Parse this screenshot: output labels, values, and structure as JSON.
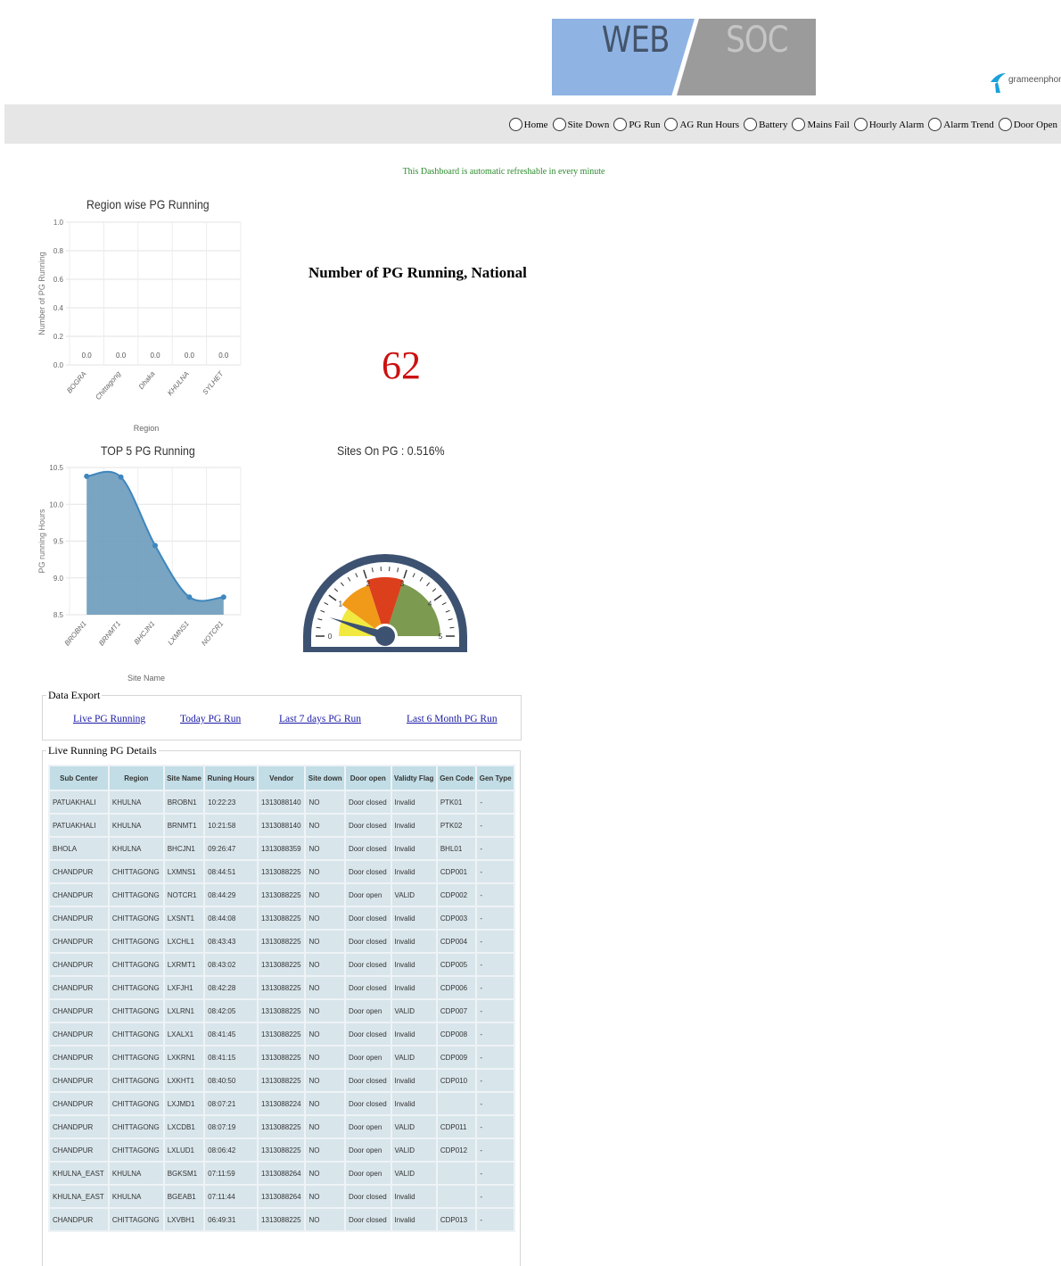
{
  "header": {
    "web_label": "WEB",
    "soc_label": "SOC",
    "logo_text": "grameenphone"
  },
  "nav": {
    "items": [
      "Home",
      "Site Down",
      "PG Run",
      "AG Run Hours",
      "Battery",
      "Mains Fail",
      "Hourly Alarm",
      "Alarm Trend",
      "Door Open"
    ]
  },
  "refresh_note": "This Dashboard is automatic refreshable in every minute",
  "national": {
    "title": "Number of PG Running, National",
    "value": "62"
  },
  "sites_on_pg": {
    "label": "Sites On PG : 0.516%",
    "gauge_value": 0.516,
    "gauge_min": 0,
    "gauge_max": 5,
    "ticks": [
      "0",
      "1",
      "2",
      "3",
      "4",
      "5"
    ]
  },
  "chart_data": [
    {
      "type": "bar",
      "title": "Region wise PG Running",
      "xlabel": "Region",
      "ylabel": "Number of PG Running",
      "categories": [
        "BOGRA",
        "Chittagong",
        "Dhaka",
        "KHULNA",
        "SYLHET"
      ],
      "values": [
        0.0,
        0.0,
        0.0,
        0.0,
        0.0
      ],
      "data_labels": [
        "0.0",
        "0.0",
        "0.0",
        "0.0",
        "0.0"
      ],
      "yticks": [
        "0.0",
        "0.2",
        "0.4",
        "0.6",
        "0.8",
        "1.0"
      ],
      "ylim": [
        0,
        1.0
      ],
      "grid": true
    },
    {
      "type": "area",
      "title": "TOP 5 PG Running",
      "xlabel": "Site Name",
      "ylabel": "PG running Hours",
      "categories": [
        "BROBN1",
        "BRNMT1",
        "BHCJN1",
        "LXMNS1",
        "NOTCR1"
      ],
      "values": [
        10.38,
        10.37,
        9.44,
        8.74,
        8.74
      ],
      "yticks": [
        "8.5",
        "9.0",
        "9.5",
        "10.0",
        "10.5"
      ],
      "ylim": [
        8.5,
        10.5
      ],
      "color": "#6a9bbd",
      "grid": true
    }
  ],
  "export": {
    "legend": "Data Export",
    "links": [
      "Live PG Running",
      "Today PG Run",
      "Last 7 days PG Run",
      "Last 6 Month PG Run"
    ]
  },
  "details": {
    "legend": "Live Running PG Details",
    "columns": [
      "Sub Center",
      "Region",
      "Site Name",
      "Runing Hours",
      "Vendor",
      "Site down",
      "Door open",
      "Validty Flag",
      "Gen Code",
      "Gen Type"
    ],
    "rows": [
      [
        "PATUAKHALI",
        "KHULNA",
        "BROBN1",
        "10:22:23",
        "1313088140",
        "NO",
        "Door closed",
        "Invalid",
        "PTK01",
        "-"
      ],
      [
        "PATUAKHALI",
        "KHULNA",
        "BRNMT1",
        "10:21:58",
        "1313088140",
        "NO",
        "Door closed",
        "Invalid",
        "PTK02",
        "-"
      ],
      [
        "BHOLA",
        "KHULNA",
        "BHCJN1",
        "09:26:47",
        "1313088359",
        "NO",
        "Door closed",
        "Invalid",
        "BHL01",
        "-"
      ],
      [
        "CHANDPUR",
        "CHITTAGONG",
        "LXMNS1",
        "08:44:51",
        "1313088225",
        "NO",
        "Door closed",
        "Invalid",
        "CDP001",
        "-"
      ],
      [
        "CHANDPUR",
        "CHITTAGONG",
        "NOTCR1",
        "08:44:29",
        "1313088225",
        "NO",
        "Door open",
        "VALID",
        "CDP002",
        "-"
      ],
      [
        "CHANDPUR",
        "CHITTAGONG",
        "LXSNT1",
        "08:44:08",
        "1313088225",
        "NO",
        "Door closed",
        "Invalid",
        "CDP003",
        "-"
      ],
      [
        "CHANDPUR",
        "CHITTAGONG",
        "LXCHL1",
        "08:43:43",
        "1313088225",
        "NO",
        "Door closed",
        "Invalid",
        "CDP004",
        "-"
      ],
      [
        "CHANDPUR",
        "CHITTAGONG",
        "LXRMT1",
        "08:43:02",
        "1313088225",
        "NO",
        "Door closed",
        "Invalid",
        "CDP005",
        "-"
      ],
      [
        "CHANDPUR",
        "CHITTAGONG",
        "LXFJH1",
        "08:42:28",
        "1313088225",
        "NO",
        "Door closed",
        "Invalid",
        "CDP006",
        "-"
      ],
      [
        "CHANDPUR",
        "CHITTAGONG",
        "LXLRN1",
        "08:42:05",
        "1313088225",
        "NO",
        "Door open",
        "VALID",
        "CDP007",
        "-"
      ],
      [
        "CHANDPUR",
        "CHITTAGONG",
        "LXALX1",
        "08:41:45",
        "1313088225",
        "NO",
        "Door closed",
        "Invalid",
        "CDP008",
        "-"
      ],
      [
        "CHANDPUR",
        "CHITTAGONG",
        "LXKRN1",
        "08:41:15",
        "1313088225",
        "NO",
        "Door open",
        "VALID",
        "CDP009",
        "-"
      ],
      [
        "CHANDPUR",
        "CHITTAGONG",
        "LXKHT1",
        "08:40:50",
        "1313088225",
        "NO",
        "Door closed",
        "Invalid",
        "CDP010",
        "-"
      ],
      [
        "CHANDPUR",
        "CHITTAGONG",
        "LXJMD1",
        "08:07:21",
        "1313088224",
        "NO",
        "Door closed",
        "Invalid",
        "",
        "-"
      ],
      [
        "CHANDPUR",
        "CHITTAGONG",
        "LXCDB1",
        "08:07:19",
        "1313088225",
        "NO",
        "Door open",
        "VALID",
        "CDP011",
        "-"
      ],
      [
        "CHANDPUR",
        "CHITTAGONG",
        "LXLUD1",
        "08:06:42",
        "1313088225",
        "NO",
        "Door open",
        "VALID",
        "CDP012",
        "-"
      ],
      [
        "KHULNA_EAST",
        "KHULNA",
        "BGKSM1",
        "07:11:59",
        "1313088264",
        "NO",
        "Door open",
        "VALID",
        "",
        "-"
      ],
      [
        "KHULNA_EAST",
        "KHULNA",
        "BGEAB1",
        "07:11:44",
        "1313088264",
        "NO",
        "Door closed",
        "Invalid",
        "",
        "-"
      ],
      [
        "CHANDPUR",
        "CHITTAGONG",
        "LXVBH1",
        "06:49:31",
        "1313088225",
        "NO",
        "Door closed",
        "Invalid",
        "CDP013",
        "-"
      ]
    ]
  }
}
